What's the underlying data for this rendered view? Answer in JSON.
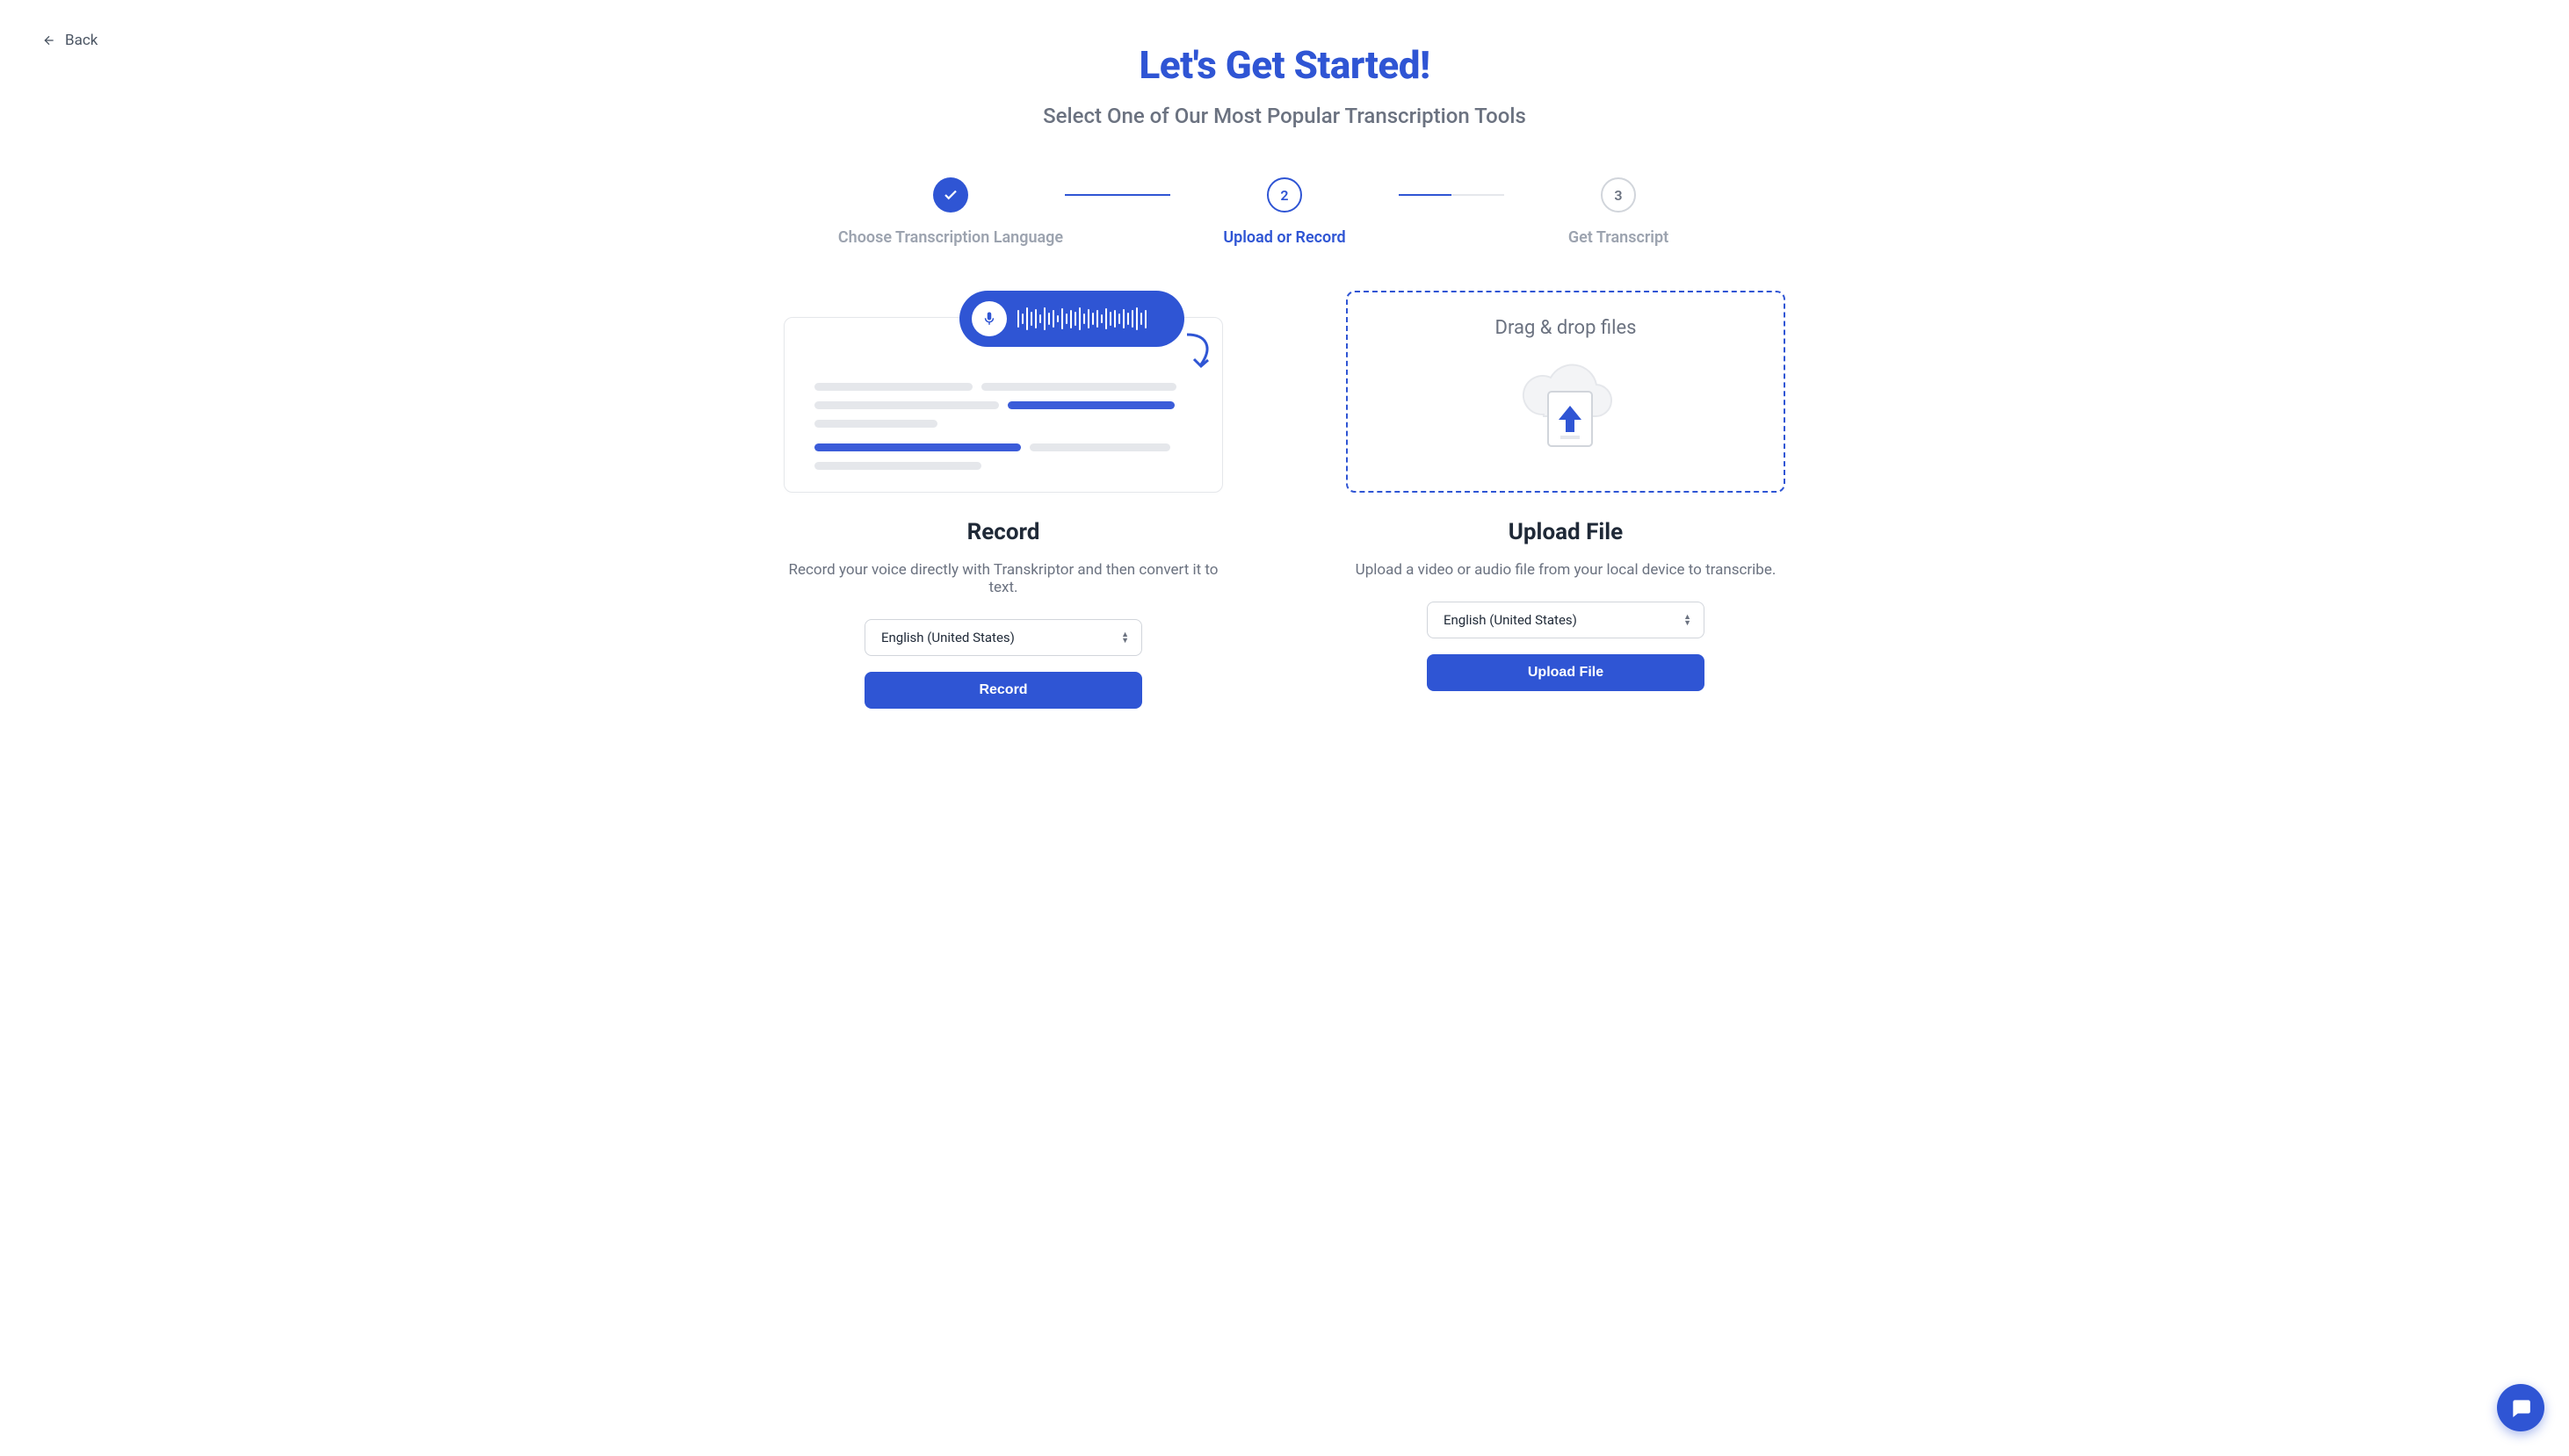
{
  "back": {
    "label": "Back"
  },
  "header": {
    "title": "Let's Get Started!",
    "subtitle": "Select One of Our Most Popular Transcription Tools"
  },
  "steps": [
    {
      "number": "1",
      "label": "Choose Transcription Language",
      "state": "done"
    },
    {
      "number": "2",
      "label": "Upload or Record",
      "state": "current"
    },
    {
      "number": "3",
      "label": "Get Transcript",
      "state": "upcoming"
    }
  ],
  "record": {
    "title": "Record",
    "desc": "Record your voice directly with Transkriptor and then convert it to text.",
    "language": "English (United States)",
    "button": "Record"
  },
  "upload": {
    "drop_label": "Drag & drop files",
    "title": "Upload File",
    "desc": "Upload a video or audio file from your local device to transcribe.",
    "language": "English (United States)",
    "button": "Upload File"
  }
}
